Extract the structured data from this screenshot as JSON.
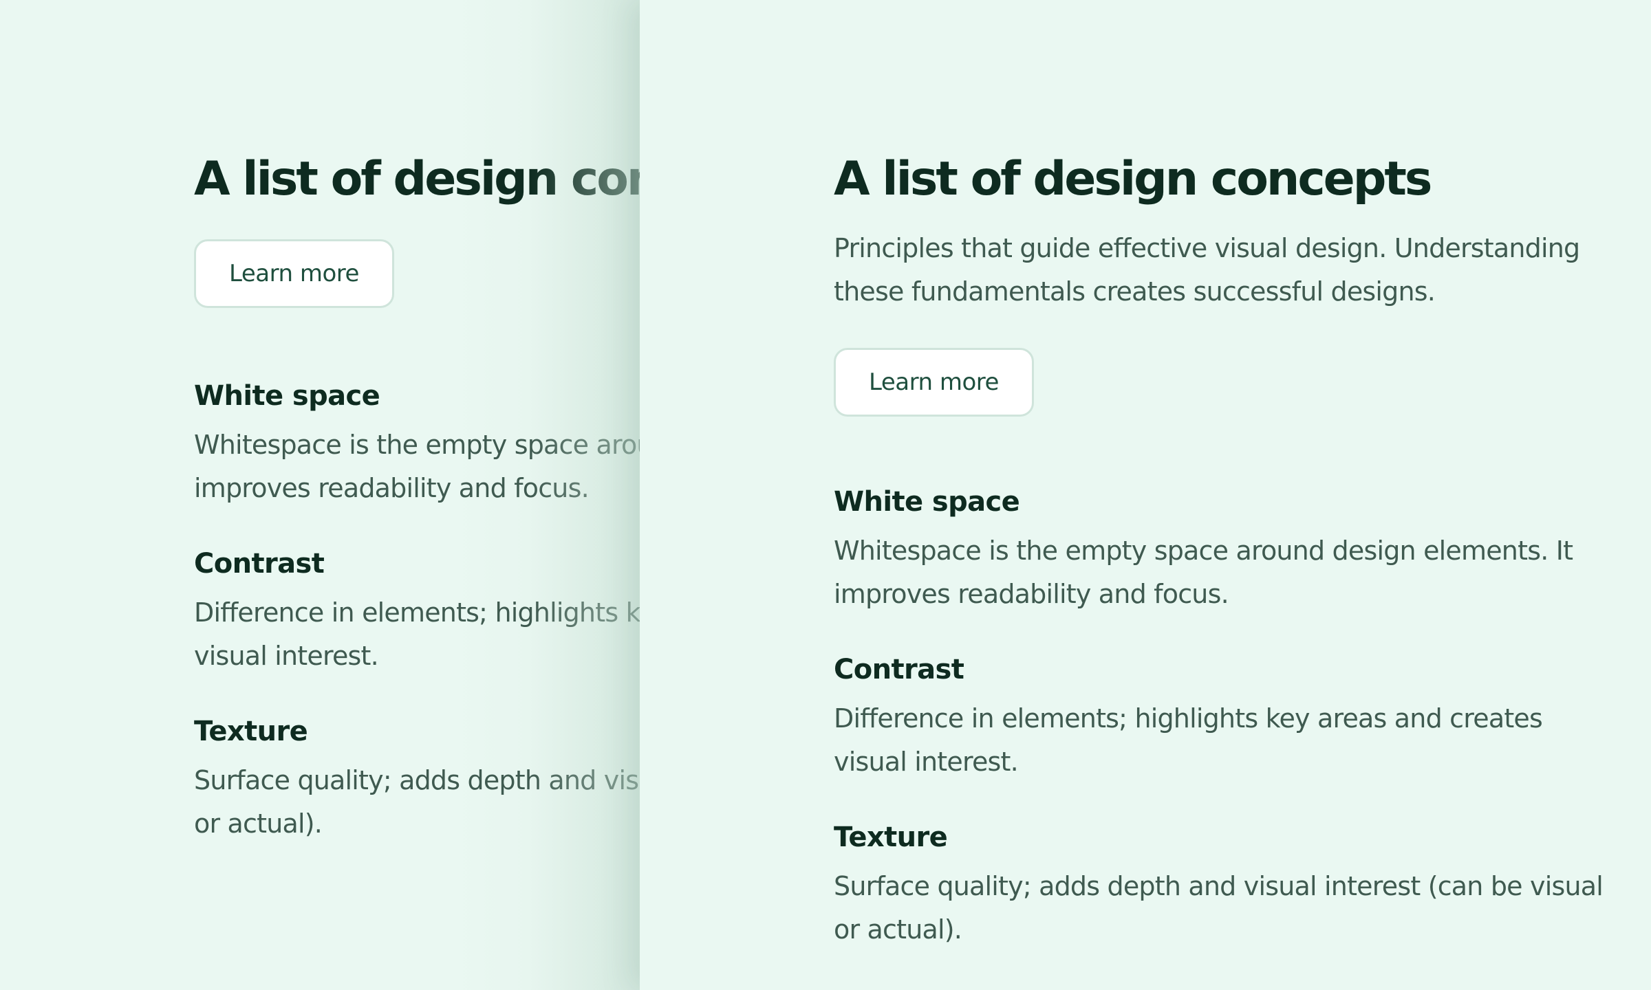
{
  "heading": "A list of design concepts",
  "subheading": "Principles that guide effective visual design. Understanding these fundamentals creates successful designs.",
  "cta_label": "Learn more",
  "concepts": [
    {
      "title": "White space",
      "description": "Whitespace is the empty space around design elements. It improves readability and focus."
    },
    {
      "title": "Contrast",
      "description": "Difference in elements; highlights key areas and creates visual interest."
    },
    {
      "title": "Texture",
      "description": "Surface quality; adds depth and visual interest (can be visual or actual)."
    }
  ],
  "colors": {
    "background": "#eaf8f2",
    "heading": "#0e2b20",
    "body_text": "#3f5a50",
    "button_text": "#1f4f3e",
    "button_border": "#cfe4db"
  }
}
